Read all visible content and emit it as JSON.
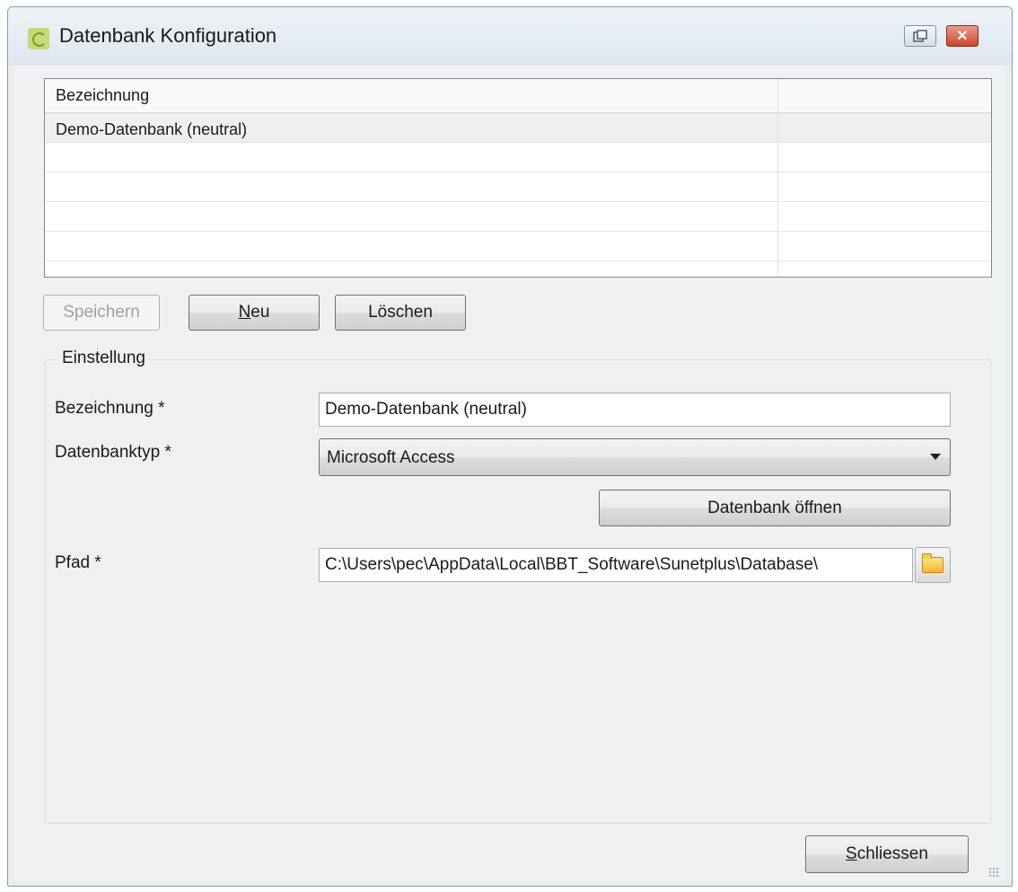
{
  "window": {
    "title": "Datenbank Konfiguration",
    "close_glyph": "✕"
  },
  "grid": {
    "header": "Bezeichnung",
    "rows": [
      "Demo-Datenbank (neutral)"
    ]
  },
  "toolbar": {
    "save_label": "Speichern",
    "new_label_mnemonic": "N",
    "new_label_rest": "eu",
    "delete_label": "Löschen"
  },
  "settings": {
    "group_title": "Einstellung",
    "name_label": "Bezeichnung *",
    "name_value": "Demo-Datenbank (neutral)",
    "dbtype_label": "Datenbanktyp *",
    "dbtype_value": "Microsoft Access",
    "open_db_label": "Datenbank öffnen",
    "path_label": "Pfad *",
    "path_value": "C:\\Users\\pec\\AppData\\Local\\BBT_Software\\Sunetplus\\Database\\"
  },
  "footer": {
    "close_label_mnemonic": "S",
    "close_label_rest": "chliessen"
  },
  "colors": {
    "window_bg": "#f0f0f0",
    "selected_row": "#efefef",
    "close_button": "#c94831"
  }
}
